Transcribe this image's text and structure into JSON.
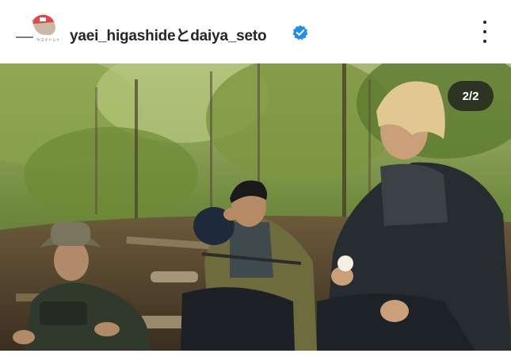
{
  "post": {
    "author_line": "yaei_higashideとdaiya_seto",
    "verified_icon": "verified-badge-icon",
    "more_icon": "more-vertical-icon",
    "avatar_icon": "profile-avatar-icon",
    "image_counter": "2/2"
  },
  "colors": {
    "username": "#262626",
    "verified": "#1f8ef1",
    "counter_bg": "#1e1e1e"
  }
}
